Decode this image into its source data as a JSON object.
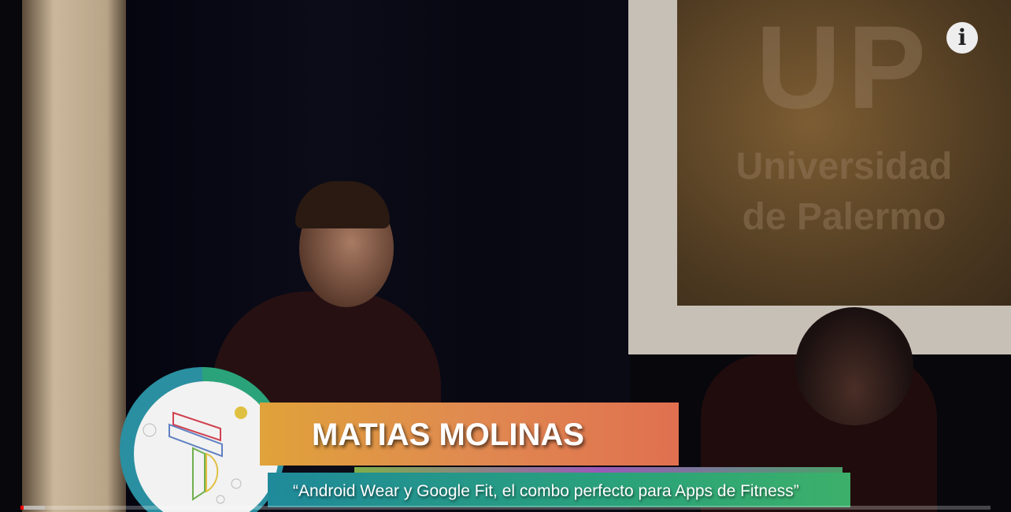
{
  "video": {
    "lower_third": {
      "speaker_name": "MATIAS MOLINAS",
      "talk_title": "“Android Wear y Google Fit, el combo perfecto para Apps de Fitness”"
    },
    "backdrop": {
      "logo_text": "UP",
      "institution_line1": "Universidad",
      "institution_line2": "de Palermo"
    },
    "info_icon": "info-icon",
    "info_glyph": "i",
    "progress": {
      "played_fraction": 0.003,
      "buffered_fraction": 0.025
    },
    "colors": {
      "progress_played": "#ff0000",
      "name_bar": "#e08a50",
      "title_bar": "#2aa27a"
    }
  }
}
